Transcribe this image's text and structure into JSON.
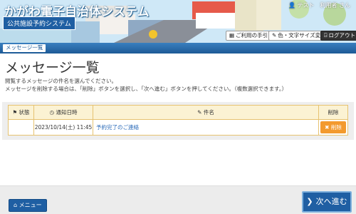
{
  "header": {
    "site_title": "かがわ電子自治体システム",
    "sub_title": "公共施設予約システム",
    "user": "テスト　利用者 さん",
    "buttons": {
      "guide": "ご利用の手引き",
      "color": "色・文字サイズ変更",
      "logout": "ログアウト"
    }
  },
  "breadcrumb": "メッセージ一覧",
  "page_title": "メッセージ一覧",
  "help": [
    "閲覧するメッセージの件名を選んでください。",
    "メッセージを削除する場合は、「削除」ボタンを選択し、「次へ進む」ボタンを押してください。（複数選択できます。）"
  ],
  "table": {
    "headers": {
      "status": "状態",
      "date": "通知日時",
      "subject": "件名",
      "delete": "削除"
    },
    "rows": [
      {
        "status": "",
        "date": "2023/10/14(土) 11:45",
        "subject": "予約完了のご連絡",
        "delete": "削除"
      }
    ]
  },
  "footer": {
    "menu": "メニュー",
    "next": "次へ進む"
  },
  "colors": {
    "accent": "#1f5fa3",
    "delete": "#f39a2e",
    "table_border": "#e6c270",
    "header_fill": "#fbf2d3"
  },
  "icons": [
    "user-icon",
    "book-icon",
    "brush-icon",
    "logout-icon",
    "flag-icon",
    "clock-icon",
    "pencil-icon",
    "close-icon",
    "home-icon",
    "chevron-right-icon"
  ]
}
